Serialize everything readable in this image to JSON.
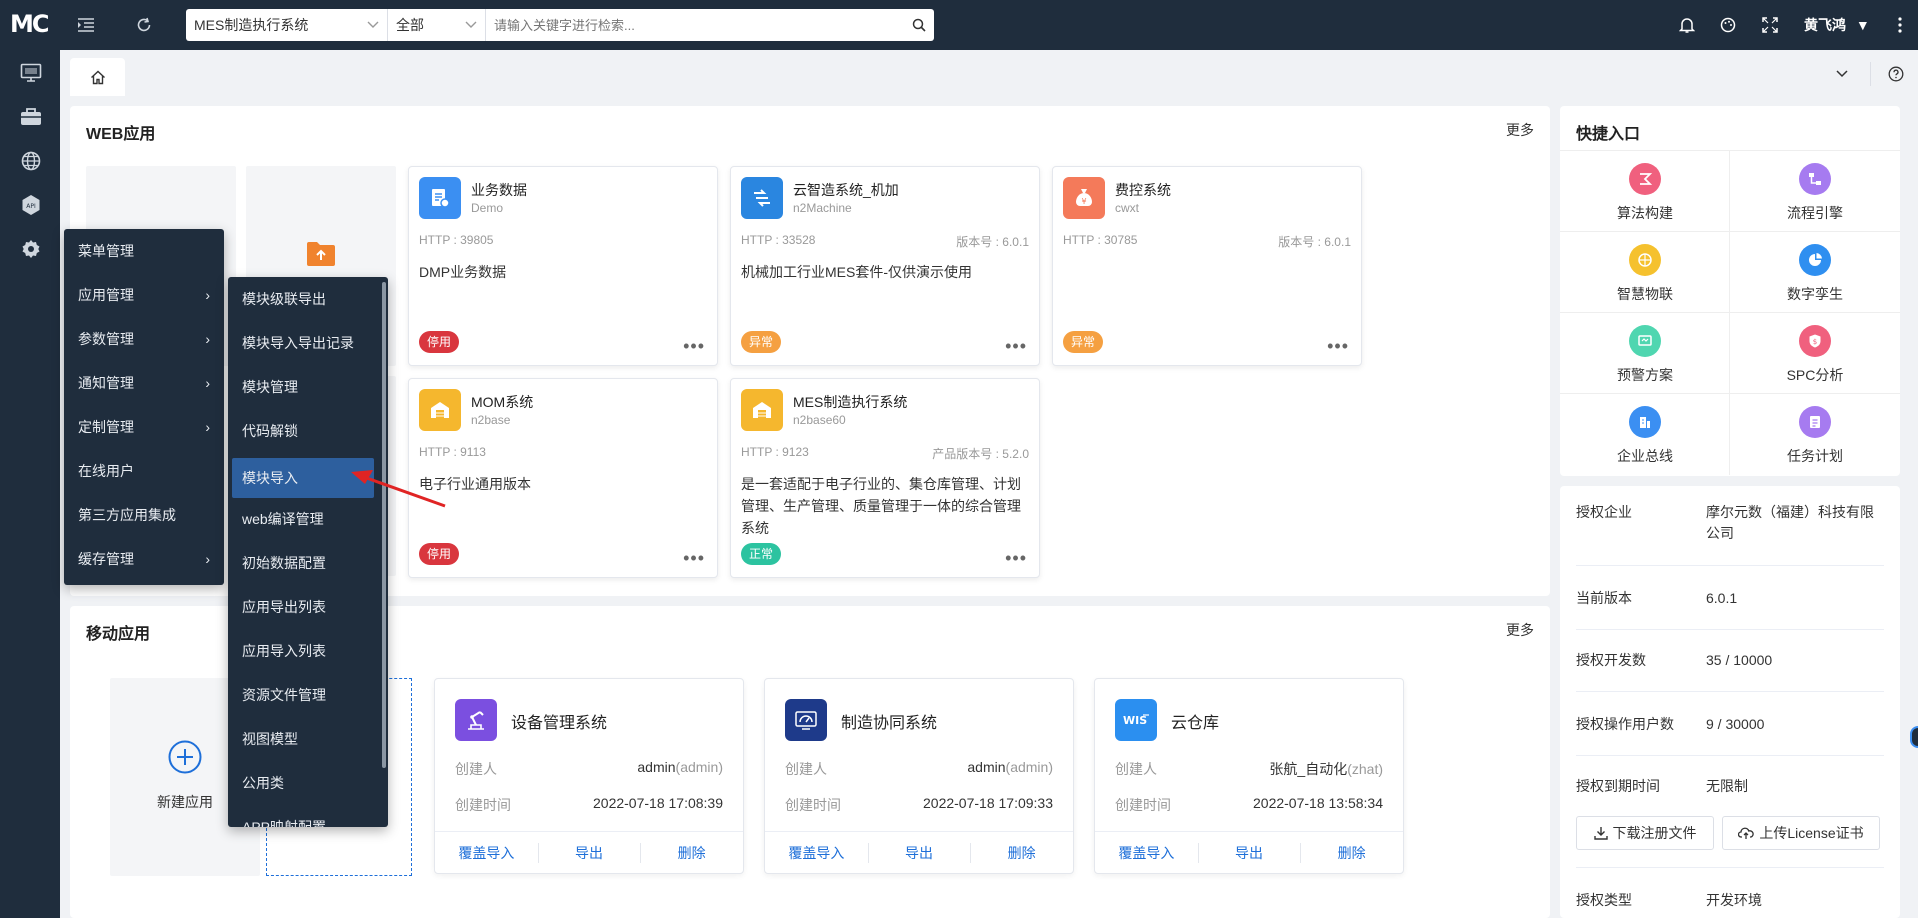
{
  "topbar": {
    "logo": "MC",
    "system_select": "MES制造执行系统",
    "scope_select": "全部",
    "search_placeholder": "请输入关键字进行检索...",
    "user_name": "黄飞鸿"
  },
  "web_apps": {
    "title": "WEB应用",
    "more": "更多",
    "cards": [
      {
        "name": "业务数据",
        "code": "Demo",
        "http": "HTTP : 39805",
        "version": "",
        "desc": "DMP业务数据",
        "status": "停用",
        "status_color": "#d9363e",
        "icon_color": "#3b8ff2"
      },
      {
        "name": "云智造系统_机加",
        "code": "n2Machine",
        "http": "HTTP : 33528",
        "version": "版本号 : 6.0.1",
        "desc": "机械加工行业MES套件-仅供演示使用",
        "status": "异常",
        "status_color": "#f5a041",
        "icon_color": "#2a86e0"
      },
      {
        "name": "费控系统",
        "code": "cwxt",
        "http": "HTTP : 30785",
        "version": "版本号 : 6.0.1",
        "desc": "",
        "status": "异常",
        "status_color": "#f5a041",
        "icon_color": "#f47a5a"
      },
      {
        "name": "MOM系统",
        "code": "n2base",
        "http": "HTTP : 9113",
        "version": "",
        "desc": "电子行业通用版本",
        "status": "停用",
        "status_color": "#d9363e",
        "icon_color": "#f5b72e"
      },
      {
        "name": "MES制造执行系统",
        "code": "n2base60",
        "http": "HTTP : 9123",
        "version": "产品版本号 : 5.2.0",
        "desc": "是一套适配于电子行业的、集仓库管理、计划管理、生产管理、质量管理于一体的综合管理系统",
        "status": "正常",
        "status_color": "#2cc3a0",
        "icon_color": "#f5b72e"
      }
    ]
  },
  "quick_entry": {
    "title": "快捷入口",
    "items": [
      {
        "label": "算法构建",
        "color": "#f0607e"
      },
      {
        "label": "流程引擎",
        "color": "#a67bf0"
      },
      {
        "label": "智慧物联",
        "color": "#f5c12e"
      },
      {
        "label": "数字孪生",
        "color": "#2f8ff0"
      },
      {
        "label": "预警方案",
        "color": "#4fd6b0"
      },
      {
        "label": "SPC分析",
        "color": "#f0607e"
      },
      {
        "label": "企业总线",
        "color": "#3b8ff2"
      },
      {
        "label": "任务计划",
        "color": "#a67bf0"
      }
    ]
  },
  "license": {
    "rows": [
      {
        "key": "授权企业",
        "value": "摩尔元数（福建）科技有限公司"
      },
      {
        "key": "当前版本",
        "value": "6.0.1"
      },
      {
        "key": "授权开发数",
        "value": "35 / 10000"
      },
      {
        "key": "授权操作用户数",
        "value": "9 / 30000"
      },
      {
        "key": "授权到期时间",
        "value": "无限制"
      },
      {
        "key": "授权类型",
        "value": "开发环境"
      }
    ],
    "download_btn": "下载注册文件",
    "upload_btn": "上传License证书"
  },
  "mobile_apps": {
    "title": "移动应用",
    "more": "更多",
    "new_app": "新建应用",
    "creator_label": "创建人",
    "time_label": "创建时间",
    "action_overwrite": "覆盖导入",
    "action_export": "导出",
    "action_delete": "删除",
    "cards": [
      {
        "name": "设备管理系统",
        "creator": "admin",
        "creator_id": "(admin)",
        "time": "2022-07-18 17:08:39",
        "icon_color": "#7b4fe0"
      },
      {
        "name": "制造协同系统",
        "creator": "admin",
        "creator_id": "(admin)",
        "time": "2022-07-18 17:09:33",
        "icon_color": "#1e3a8a"
      },
      {
        "name": "云仓库",
        "creator": "张航_自动化",
        "creator_id": "(zhat)",
        "time": "2022-07-18 13:58:34",
        "icon_color": "#2b8ff0"
      }
    ]
  },
  "menu_level1": [
    {
      "label": "菜单管理",
      "has_sub": false
    },
    {
      "label": "应用管理",
      "has_sub": true
    },
    {
      "label": "参数管理",
      "has_sub": true
    },
    {
      "label": "通知管理",
      "has_sub": true
    },
    {
      "label": "定制管理",
      "has_sub": true
    },
    {
      "label": "在线用户",
      "has_sub": false
    },
    {
      "label": "第三方应用集成",
      "has_sub": false
    },
    {
      "label": "缓存管理",
      "has_sub": true
    }
  ],
  "menu_level2": [
    "模块级联导出",
    "模块导入导出记录",
    "模块管理",
    "代码解锁",
    "模块导入",
    "web编译管理",
    "初始数据配置",
    "应用导出列表",
    "应用导入列表",
    "资源文件管理",
    "视图模型",
    "公用类",
    "APP映射配置"
  ],
  "menu_level2_active": "模块导入"
}
